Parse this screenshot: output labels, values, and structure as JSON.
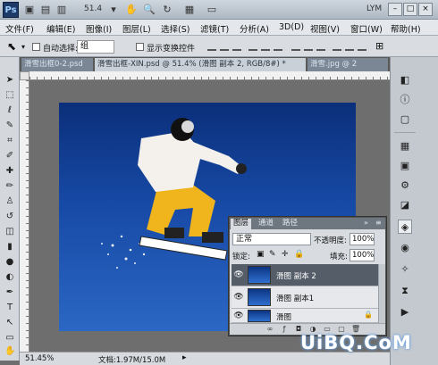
{
  "app": {
    "logo": "Ps",
    "zoom_display": "51.4",
    "workspace": "LYM"
  },
  "window_buttons": [
    "–",
    "□",
    "×"
  ],
  "menu": [
    "文件(F)",
    "编辑(E)",
    "图像(I)",
    "图层(L)",
    "选择(S)",
    "滤镜(T)",
    "分析(A)",
    "3D(D)",
    "视图(V)",
    "窗口(W)",
    "帮助(H)"
  ],
  "options": {
    "auto_select_label": "自动选择:",
    "auto_select_value": "组",
    "show_transform_label": "显示变换控件"
  },
  "tabs": [
    {
      "label": "滑雪出框0-2.psd",
      "active": false
    },
    {
      "label": "滑雪出框-XIN.psd @ 51.4% (滑图 副本 2, RGB/8#) *",
      "active": true
    },
    {
      "label": "滑雪.jpg @ 2",
      "active": false
    }
  ],
  "status": {
    "zoom": "51.45%",
    "doc": "文档:1.97M/15.0M"
  },
  "layers_panel": {
    "tabs": [
      "图层",
      "通道",
      "路径"
    ],
    "blend_mode": "正常",
    "opacity_label": "不透明度:",
    "opacity_value": "100%",
    "lock_label": "锁定:",
    "fill_label": "填充:",
    "fill_value": "100%",
    "layers": [
      {
        "name": "滑图 副本 2",
        "selected": true
      },
      {
        "name": "滑图 副本1",
        "selected": false
      },
      {
        "name": "滑图",
        "selected": false
      }
    ]
  },
  "watermark": "UiBQ.CoM",
  "colors": {
    "accent": "#1e3a66",
    "sky": "#174aa6",
    "selected_layer": "#555e68"
  }
}
